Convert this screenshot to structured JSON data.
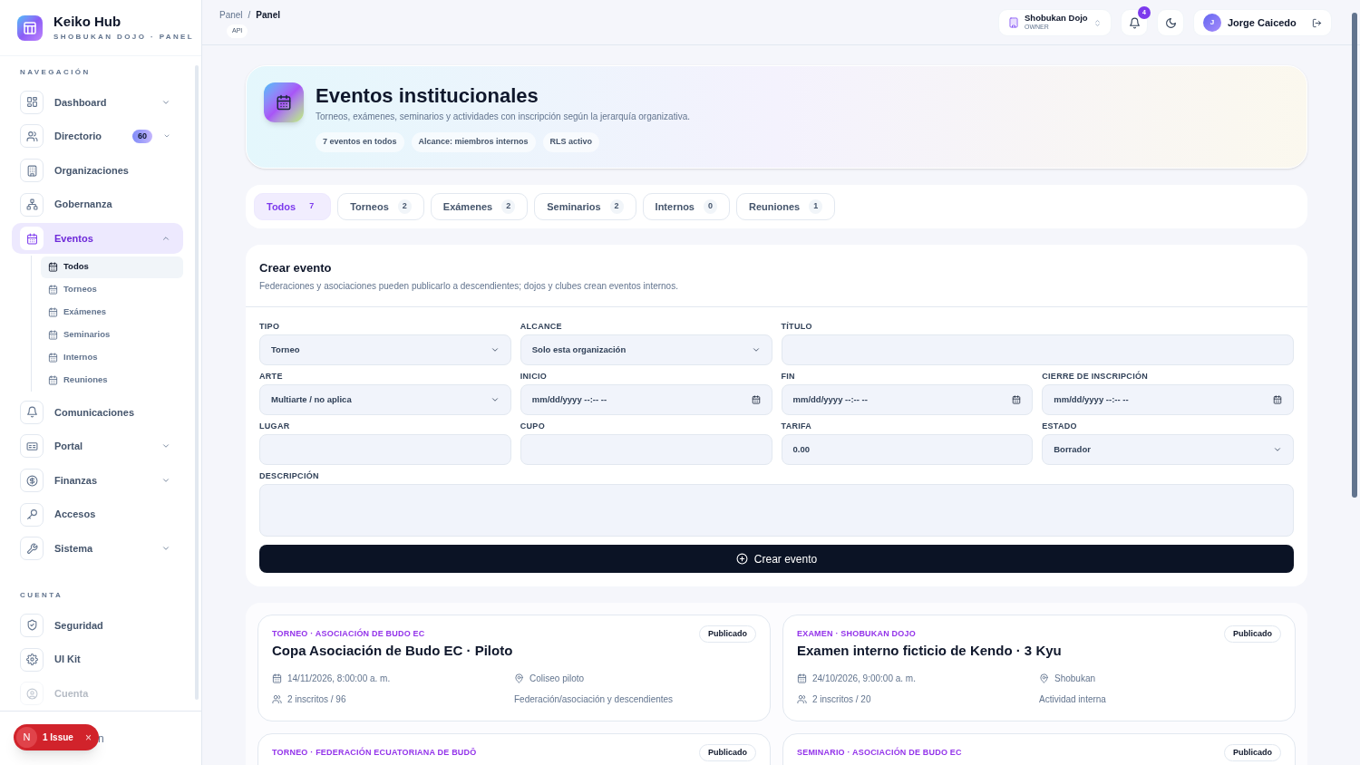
{
  "brand": {
    "name": "Keiko Hub",
    "subtitle": "SHOBUKAN DOJO · PANEL"
  },
  "sidebar": {
    "sections": [
      {
        "heading": "NAVEGACIÓN",
        "items": [
          {
            "label": "Dashboard",
            "selected": false,
            "expanded": false,
            "disabled": false
          },
          {
            "label": "Directorio",
            "badge": "60",
            "selected": false,
            "expanded": false,
            "disabled": false
          },
          {
            "label": "Organizaciones",
            "selected": false,
            "disabled": false
          },
          {
            "label": "Gobernanza",
            "selected": false,
            "disabled": false
          },
          {
            "label": "Eventos",
            "selected": true,
            "expanded": true,
            "disabled": false,
            "children": [
              {
                "label": "Todos",
                "selected": true
              },
              {
                "label": "Torneos",
                "selected": false
              },
              {
                "label": "Exámenes",
                "selected": false
              },
              {
                "label": "Seminarios",
                "selected": false
              },
              {
                "label": "Internos",
                "selected": false
              },
              {
                "label": "Reuniones",
                "selected": false
              }
            ]
          },
          {
            "label": "Comunicaciones",
            "selected": false,
            "disabled": false
          },
          {
            "label": "Portal",
            "selected": false,
            "expanded": false,
            "disabled": false
          },
          {
            "label": "Finanzas",
            "selected": false,
            "expanded": false,
            "disabled": false
          },
          {
            "label": "Accesos",
            "selected": false,
            "disabled": false
          },
          {
            "label": "Sistema",
            "selected": false,
            "expanded": false,
            "disabled": false
          }
        ]
      },
      {
        "heading": "CUENTA",
        "items": [
          {
            "label": "Seguridad",
            "selected": false,
            "disabled": false
          },
          {
            "label": "UI Kit",
            "selected": false,
            "disabled": false
          },
          {
            "label": "Cuenta",
            "selected": false,
            "disabled": true
          }
        ]
      }
    ],
    "footer_text": "n"
  },
  "issue_badge": {
    "logo": "N",
    "label": "1 Issue",
    "close": "×"
  },
  "topbar": {
    "breadcrumb": [
      "Panel",
      "Panel"
    ],
    "separator": "/",
    "tag": "API",
    "org": {
      "name": "Shobukan Dojo",
      "role": "OWNER"
    },
    "notifications": "4",
    "user": {
      "initial": "J",
      "name": "Jorge Caicedo"
    }
  },
  "hero": {
    "title": "Eventos institucionales",
    "subtitle": "Torneos, exámenes, seminarios y actividades con inscripción según la jerarquía organizativa.",
    "chips": [
      "7 eventos en todos",
      "Alcance: miembros internos",
      "RLS activo"
    ]
  },
  "tabs": [
    {
      "label": "Todos",
      "count": "7",
      "selected": true
    },
    {
      "label": "Torneos",
      "count": "2",
      "selected": false
    },
    {
      "label": "Exámenes",
      "count": "2",
      "selected": false
    },
    {
      "label": "Seminarios",
      "count": "2",
      "selected": false
    },
    {
      "label": "Internos",
      "count": "0",
      "selected": false
    },
    {
      "label": "Reuniones",
      "count": "1",
      "selected": false
    }
  ],
  "form": {
    "title": "Crear evento",
    "subtitle": "Federaciones y asociaciones pueden publicarlo a descendientes; dojos y clubes crean eventos internos.",
    "rows": [
      [
        {
          "label": "TIPO",
          "kind": "select",
          "value": "Torneo"
        },
        {
          "label": "ALCANCE",
          "kind": "select",
          "value": "Solo esta organización"
        },
        {
          "label": "TÍTULO",
          "kind": "input"
        }
      ],
      [
        {
          "label": "ARTE",
          "kind": "select",
          "value": "Multiarte / no aplica"
        },
        {
          "label": "INICIO",
          "kind": "date",
          "value": "mm/dd/yyyy --:-- --"
        },
        {
          "label": "FIN",
          "kind": "date",
          "value": "mm/dd/yyyy --:-- --"
        },
        {
          "label": "CIERRE DE INSCRIPCIÓN",
          "kind": "date",
          "value": "mm/dd/yyyy --:-- --"
        }
      ],
      [
        {
          "label": "LUGAR",
          "kind": "input"
        },
        {
          "label": "CUPO",
          "kind": "input"
        },
        {
          "label": "TARIFA",
          "kind": "input",
          "value": "0.00"
        },
        {
          "label": "ESTADO",
          "kind": "select",
          "value": "Borrador"
        }
      ],
      [
        {
          "label": "DESCRIPCIÓN",
          "kind": "textarea"
        }
      ]
    ],
    "submit": "Crear evento"
  },
  "events": [
    {
      "eyebrow": "TORNEO · ASOCIACIÓN DE BUDO EC",
      "title": "Copa Asociación de Budo EC · Piloto",
      "status": "Publicado",
      "date": "14/11/2026, 8:00:00 a. m.",
      "place": "Coliseo piloto",
      "enrolled": "2 inscritos / 96",
      "scope": "Federación/asociación y descendientes"
    },
    {
      "eyebrow": "EXAMEN · SHOBUKAN DOJO",
      "title": "Examen interno ficticio de Kendo · 3 Kyu",
      "status": "Publicado",
      "date": "24/10/2026, 9:00:00 a. m.",
      "place": "Shobukan",
      "enrolled": "2 inscritos / 20",
      "scope": "Actividad interna"
    },
    {
      "eyebrow": "TORNEO · FEDERACIÓN ECUATORIANA DE BUDŌ",
      "status": "Publicado"
    },
    {
      "eyebrow": "SEMINARIO · ASOCIACIÓN DE BUDO EC",
      "status": "Publicado"
    }
  ]
}
